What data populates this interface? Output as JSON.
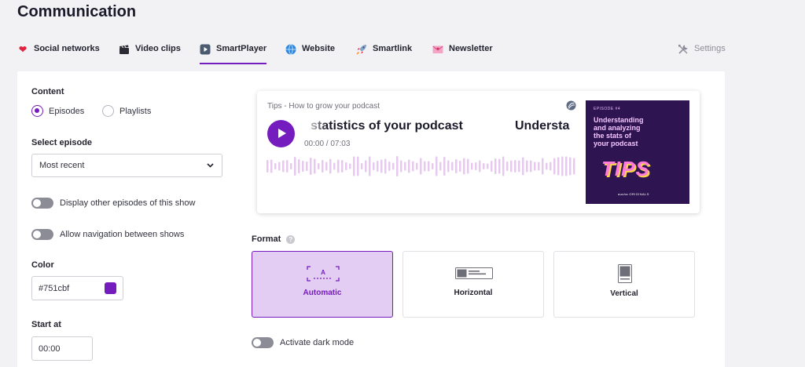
{
  "page_title": "Communication",
  "tabs": [
    {
      "label": "Social networks",
      "icon": "heart-icon"
    },
    {
      "label": "Video clips",
      "icon": "clapperboard-icon"
    },
    {
      "label": "SmartPlayer",
      "icon": "play-square-icon",
      "active": true
    },
    {
      "label": "Website",
      "icon": "globe-icon"
    },
    {
      "label": "Smartlink",
      "icon": "rocket-icon"
    },
    {
      "label": "Newsletter",
      "icon": "envelope-icon"
    }
  ],
  "settings_label": "Settings",
  "content": {
    "label": "Content",
    "options": [
      "Episodes",
      "Playlists"
    ],
    "selected": "Episodes"
  },
  "select_episode": {
    "label": "Select episode",
    "value": "Most recent"
  },
  "toggles": {
    "display_other": "Display other episodes of this show",
    "allow_navigation": "Allow navigation between shows"
  },
  "color": {
    "label": "Color",
    "value": "#751cbf",
    "hex": "#751cbf"
  },
  "start_at": {
    "label": "Start at",
    "value": "00:00"
  },
  "player": {
    "title": "Tips - How to grow your podcast",
    "marquee_text": "statistics of your podcast",
    "marquee_next": "Understa",
    "time": "00:00 / 07:03",
    "cover": {
      "episode": "EPISODE #4",
      "headline_1": "Understanding",
      "headline_2": "and analyzing",
      "headline_3": "the stats of",
      "headline_4": "your podcast",
      "tips": "TIPS",
      "brand": "ausha ORIGINALS"
    }
  },
  "format": {
    "label": "Format",
    "options": [
      "Automatic",
      "Horizontal",
      "Vertical"
    ],
    "selected": "Automatic"
  },
  "dark_mode_label": "Activate dark mode",
  "colors": {
    "accent": "#751cbf",
    "accent_light": "#e4cdf2",
    "waveform": "#e7c9ef"
  }
}
